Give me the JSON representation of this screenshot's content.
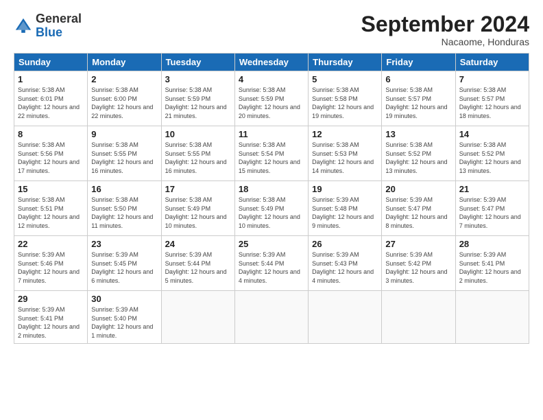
{
  "header": {
    "logo_general": "General",
    "logo_blue": "Blue",
    "month_title": "September 2024",
    "subtitle": "Nacaome, Honduras"
  },
  "weekdays": [
    "Sunday",
    "Monday",
    "Tuesday",
    "Wednesday",
    "Thursday",
    "Friday",
    "Saturday"
  ],
  "weeks": [
    [
      {
        "day": "1",
        "sunrise": "5:38 AM",
        "sunset": "6:01 PM",
        "daylight": "12 hours and 22 minutes."
      },
      {
        "day": "2",
        "sunrise": "5:38 AM",
        "sunset": "6:00 PM",
        "daylight": "12 hours and 22 minutes."
      },
      {
        "day": "3",
        "sunrise": "5:38 AM",
        "sunset": "5:59 PM",
        "daylight": "12 hours and 21 minutes."
      },
      {
        "day": "4",
        "sunrise": "5:38 AM",
        "sunset": "5:59 PM",
        "daylight": "12 hours and 20 minutes."
      },
      {
        "day": "5",
        "sunrise": "5:38 AM",
        "sunset": "5:58 PM",
        "daylight": "12 hours and 19 minutes."
      },
      {
        "day": "6",
        "sunrise": "5:38 AM",
        "sunset": "5:57 PM",
        "daylight": "12 hours and 19 minutes."
      },
      {
        "day": "7",
        "sunrise": "5:38 AM",
        "sunset": "5:57 PM",
        "daylight": "12 hours and 18 minutes."
      }
    ],
    [
      {
        "day": "8",
        "sunrise": "5:38 AM",
        "sunset": "5:56 PM",
        "daylight": "12 hours and 17 minutes."
      },
      {
        "day": "9",
        "sunrise": "5:38 AM",
        "sunset": "5:55 PM",
        "daylight": "12 hours and 16 minutes."
      },
      {
        "day": "10",
        "sunrise": "5:38 AM",
        "sunset": "5:55 PM",
        "daylight": "12 hours and 16 minutes."
      },
      {
        "day": "11",
        "sunrise": "5:38 AM",
        "sunset": "5:54 PM",
        "daylight": "12 hours and 15 minutes."
      },
      {
        "day": "12",
        "sunrise": "5:38 AM",
        "sunset": "5:53 PM",
        "daylight": "12 hours and 14 minutes."
      },
      {
        "day": "13",
        "sunrise": "5:38 AM",
        "sunset": "5:52 PM",
        "daylight": "12 hours and 13 minutes."
      },
      {
        "day": "14",
        "sunrise": "5:38 AM",
        "sunset": "5:52 PM",
        "daylight": "12 hours and 13 minutes."
      }
    ],
    [
      {
        "day": "15",
        "sunrise": "5:38 AM",
        "sunset": "5:51 PM",
        "daylight": "12 hours and 12 minutes."
      },
      {
        "day": "16",
        "sunrise": "5:38 AM",
        "sunset": "5:50 PM",
        "daylight": "12 hours and 11 minutes."
      },
      {
        "day": "17",
        "sunrise": "5:38 AM",
        "sunset": "5:49 PM",
        "daylight": "12 hours and 10 minutes."
      },
      {
        "day": "18",
        "sunrise": "5:38 AM",
        "sunset": "5:49 PM",
        "daylight": "12 hours and 10 minutes."
      },
      {
        "day": "19",
        "sunrise": "5:39 AM",
        "sunset": "5:48 PM",
        "daylight": "12 hours and 9 minutes."
      },
      {
        "day": "20",
        "sunrise": "5:39 AM",
        "sunset": "5:47 PM",
        "daylight": "12 hours and 8 minutes."
      },
      {
        "day": "21",
        "sunrise": "5:39 AM",
        "sunset": "5:47 PM",
        "daylight": "12 hours and 7 minutes."
      }
    ],
    [
      {
        "day": "22",
        "sunrise": "5:39 AM",
        "sunset": "5:46 PM",
        "daylight": "12 hours and 7 minutes."
      },
      {
        "day": "23",
        "sunrise": "5:39 AM",
        "sunset": "5:45 PM",
        "daylight": "12 hours and 6 minutes."
      },
      {
        "day": "24",
        "sunrise": "5:39 AM",
        "sunset": "5:44 PM",
        "daylight": "12 hours and 5 minutes."
      },
      {
        "day": "25",
        "sunrise": "5:39 AM",
        "sunset": "5:44 PM",
        "daylight": "12 hours and 4 minutes."
      },
      {
        "day": "26",
        "sunrise": "5:39 AM",
        "sunset": "5:43 PM",
        "daylight": "12 hours and 4 minutes."
      },
      {
        "day": "27",
        "sunrise": "5:39 AM",
        "sunset": "5:42 PM",
        "daylight": "12 hours and 3 minutes."
      },
      {
        "day": "28",
        "sunrise": "5:39 AM",
        "sunset": "5:41 PM",
        "daylight": "12 hours and 2 minutes."
      }
    ],
    [
      {
        "day": "29",
        "sunrise": "5:39 AM",
        "sunset": "5:41 PM",
        "daylight": "12 hours and 2 minutes."
      },
      {
        "day": "30",
        "sunrise": "5:39 AM",
        "sunset": "5:40 PM",
        "daylight": "12 hours and 1 minute."
      },
      null,
      null,
      null,
      null,
      null
    ]
  ]
}
